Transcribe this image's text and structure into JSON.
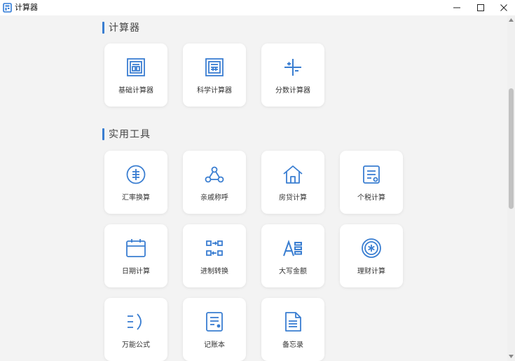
{
  "window": {
    "title": "计算器",
    "controls": {
      "minimize": "minimize",
      "maximize": "maximize",
      "close": "close"
    }
  },
  "sections": [
    {
      "title": "计算器",
      "items": [
        {
          "label": "基础计算器",
          "icon": "basic-calculator-icon"
        },
        {
          "label": "科学计算器",
          "icon": "scientific-calculator-icon"
        },
        {
          "label": "分数计算器",
          "icon": "fraction-calculator-icon"
        }
      ]
    },
    {
      "title": "实用工具",
      "items": [
        {
          "label": "汇率换算",
          "icon": "currency-exchange-icon"
        },
        {
          "label": "亲戚称呼",
          "icon": "relatives-network-icon"
        },
        {
          "label": "房贷计算",
          "icon": "house-icon"
        },
        {
          "label": "个税计算",
          "icon": "tax-document-icon"
        },
        {
          "label": "日期计算",
          "icon": "calendar-icon"
        },
        {
          "label": "进制转换",
          "icon": "base-conversion-icon"
        },
        {
          "label": "大写金额",
          "icon": "uppercase-amount-icon"
        },
        {
          "label": "理财计算",
          "icon": "finance-icon"
        },
        {
          "label": "万能公式",
          "icon": "formula-icon"
        },
        {
          "label": "记账本",
          "icon": "ledger-icon"
        },
        {
          "label": "备忘录",
          "icon": "memo-icon"
        }
      ]
    }
  ],
  "colors": {
    "accent": "#3a7ed1",
    "card": "#ffffff",
    "background": "#f3f3f3"
  }
}
